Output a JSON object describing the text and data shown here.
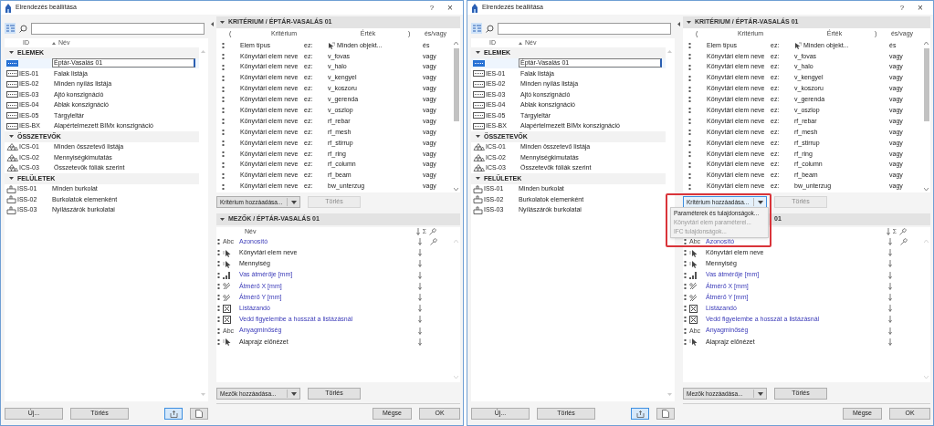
{
  "dialogs": [
    {
      "title": "Elrendezés beállítása",
      "help": "?",
      "close": "×",
      "list": {
        "columns": [
          "ID",
          "Név"
        ],
        "groups": [
          {
            "label": "ELEMEK",
            "expanded": true,
            "kind": "elements",
            "items": [
              {
                "name": "Éptár-Vasalás 01",
                "selected": true
              },
              {
                "id": "IES-01",
                "name": "Falak listája",
                "selected": false
              },
              {
                "id": "IES-02",
                "name": "Minden nyílás listája",
                "selected": false
              },
              {
                "id": "IES-03",
                "name": "Ajtó konszignáció",
                "selected": false
              },
              {
                "id": "IES-04",
                "name": "Ablak konszignáció",
                "selected": false
              },
              {
                "id": "IES-05",
                "name": "Tárgyleltár",
                "selected": false
              },
              {
                "id": "IES-BX",
                "name": "Alapértelmezett BIMx konszignáció",
                "selected": false
              }
            ]
          },
          {
            "label": "ÖSSZETEVŐK",
            "expanded": true,
            "kind": "components",
            "items": [
              {
                "id": "ICS-01",
                "name": "Minden összetevő listája",
                "selected": false
              },
              {
                "id": "ICS-02",
                "name": "Mennyiségkimutatás",
                "selected": false
              },
              {
                "id": "ICS-03",
                "name": "Összetevők fóliák szerint",
                "selected": false
              }
            ]
          },
          {
            "label": "FELÜLETEK",
            "expanded": true,
            "kind": "surfaces",
            "items": [
              {
                "id": "ISS-01",
                "name": "Minden burkolat",
                "selected": false
              },
              {
                "id": "ISS-02",
                "name": "Burkolatok elemenként",
                "selected": false
              },
              {
                "id": "ISS-03",
                "name": "Nyílászárók burkolatai",
                "selected": false
              }
            ]
          }
        ]
      },
      "criteria": {
        "title": "KRITÉRIUM / ÉPTÁR-VASALÁS 01",
        "expanded": true,
        "columns": [
          "(",
          "Kritérium",
          "Érték",
          ")",
          "és/vagy"
        ],
        "rows": [
          {
            "kind": "type",
            "criterion": "Elem típus",
            "operator": "ez:",
            "value": "Minden objekt...",
            "logic": "és"
          },
          {
            "kind": "name",
            "criterion": "Könyvtári elem neve",
            "operator": "ez:",
            "value": "v_fovas",
            "logic": "vagy"
          },
          {
            "kind": "name",
            "criterion": "Könyvtári elem neve",
            "operator": "ez:",
            "value": "v_halo",
            "logic": "vagy"
          },
          {
            "kind": "name",
            "criterion": "Könyvtári elem neve",
            "operator": "ez:",
            "value": "v_kengyel",
            "logic": "vagy"
          },
          {
            "kind": "name",
            "criterion": "Könyvtári elem neve",
            "operator": "ez:",
            "value": "v_koszoru",
            "logic": "vagy"
          },
          {
            "kind": "name",
            "criterion": "Könyvtári elem neve",
            "operator": "ez:",
            "value": "v_gerenda",
            "logic": "vagy"
          },
          {
            "kind": "name",
            "criterion": "Könyvtári elem neve",
            "operator": "ez:",
            "value": "v_oszlop",
            "logic": "vagy"
          },
          {
            "kind": "name",
            "criterion": "Könyvtári elem neve",
            "operator": "ez:",
            "value": "rf_rebar",
            "logic": "vagy"
          },
          {
            "kind": "name",
            "criterion": "Könyvtári elem neve",
            "operator": "ez:",
            "value": "rf_mesh",
            "logic": "vagy"
          },
          {
            "kind": "name",
            "criterion": "Könyvtári elem neve",
            "operator": "ez:",
            "value": "rf_stirrup",
            "logic": "vagy"
          },
          {
            "kind": "name",
            "criterion": "Könyvtári elem neve",
            "operator": "ez:",
            "value": "rf_ring",
            "logic": "vagy"
          },
          {
            "kind": "name",
            "criterion": "Könyvtári elem neve",
            "operator": "ez:",
            "value": "rf_column",
            "logic": "vagy"
          },
          {
            "kind": "name",
            "criterion": "Könyvtári elem neve",
            "operator": "ez:",
            "value": "rf_beam",
            "logic": "vagy"
          },
          {
            "kind": "name",
            "criterion": "Könyvtári elem neve",
            "operator": "ez:",
            "value": "bw_unterzug",
            "logic": "vagy"
          }
        ],
        "add": "Kritérium hozzáadása...",
        "add_open": false,
        "delete": "Törlés",
        "delete_disabled": true
      },
      "fields": {
        "title": "MEZŐK / ÉPTÁR-VASALÁS 01",
        "expanded": true,
        "column": "Név",
        "sum_label": "Σ",
        "rows": [
          {
            "kind": "text",
            "icon_label": "Abc",
            "name": "Azonosító",
            "parameter": true,
            "pinned": true
          },
          {
            "kind": "pointer",
            "name": "Könyvtári elem neve",
            "parameter": false,
            "pinned": false
          },
          {
            "kind": "pointer",
            "name": "Mennyiség",
            "parameter": false,
            "pinned": false
          },
          {
            "kind": "bars",
            "name": "Vas átmérője [mm]",
            "parameter": true,
            "pinned": false
          },
          {
            "kind": "diameter",
            "name": "Átmérő X [mm]",
            "parameter": true,
            "pinned": false
          },
          {
            "kind": "diameter",
            "name": "Átmérő Y [mm]",
            "parameter": true,
            "pinned": false
          },
          {
            "kind": "check",
            "name": "Listázandó",
            "parameter": true,
            "pinned": false
          },
          {
            "kind": "check",
            "name": "Vedd figyelembe a hosszát a listázásnál",
            "parameter": true,
            "pinned": false
          },
          {
            "kind": "text",
            "icon_label": "Abc",
            "name": "Anyagminőség",
            "parameter": true,
            "pinned": false
          },
          {
            "kind": "pointer",
            "name": "Alaprajz előnézet",
            "parameter": false,
            "pinned": false
          }
        ],
        "add": "Mezők hozzáadása...",
        "delete": "Törlés",
        "delete_disabled": false
      },
      "new": "Új...",
      "delete": "Törlés",
      "view_buttons": [
        {
          "selected": true
        },
        {
          "selected": false
        }
      ],
      "cancel": "Mégse",
      "ok": "OK"
    },
    {
      "title": "Elrendezés beállítása",
      "help": "?",
      "close": "×",
      "list": {
        "columns": [
          "ID",
          "Név"
        ],
        "groups": [
          {
            "label": "ELEMEK",
            "expanded": true,
            "kind": "elements",
            "items": [
              {
                "name": "Éptár-Vasalás 01",
                "selected": true
              },
              {
                "id": "IES-01",
                "name": "Falak listája",
                "selected": false
              },
              {
                "id": "IES-02",
                "name": "Minden nyílás listája",
                "selected": false
              },
              {
                "id": "IES-03",
                "name": "Ajtó konszignáció",
                "selected": false
              },
              {
                "id": "IES-04",
                "name": "Ablak konszignáció",
                "selected": false
              },
              {
                "id": "IES-05",
                "name": "Tárgyleltár",
                "selected": false
              },
              {
                "id": "IES-BX",
                "name": "Alapértelmezett BIMx konszignáció",
                "selected": false
              }
            ]
          },
          {
            "label": "ÖSSZETEVŐK",
            "expanded": true,
            "kind": "components",
            "items": [
              {
                "id": "ICS-01",
                "name": "Minden összetevő listája",
                "selected": false
              },
              {
                "id": "ICS-02",
                "name": "Mennyiségkimutatás",
                "selected": false
              },
              {
                "id": "ICS-03",
                "name": "Összetevők fóliák szerint",
                "selected": false
              }
            ]
          },
          {
            "label": "FELÜLETEK",
            "expanded": true,
            "kind": "surfaces",
            "items": [
              {
                "id": "ISS-01",
                "name": "Minden burkolat",
                "selected": false
              },
              {
                "id": "ISS-02",
                "name": "Burkolatok elemenként",
                "selected": false
              },
              {
                "id": "ISS-03",
                "name": "Nyílászárók burkolatai",
                "selected": false
              }
            ]
          }
        ]
      },
      "criteria": {
        "title": "KRITÉRIUM / ÉPTÁR-VASALÁS 01",
        "expanded": true,
        "columns": [
          "(",
          "Kritérium",
          "Érték",
          ")",
          "és/vagy"
        ],
        "rows": [
          {
            "kind": "type",
            "criterion": "Elem típus",
            "operator": "ez:",
            "value": "Minden objekt...",
            "logic": "és"
          },
          {
            "kind": "name",
            "criterion": "Könyvtári elem neve",
            "operator": "ez:",
            "value": "v_fovas",
            "logic": "vagy"
          },
          {
            "kind": "name",
            "criterion": "Könyvtári elem neve",
            "operator": "ez:",
            "value": "v_halo",
            "logic": "vagy"
          },
          {
            "kind": "name",
            "criterion": "Könyvtári elem neve",
            "operator": "ez:",
            "value": "v_kengyel",
            "logic": "vagy"
          },
          {
            "kind": "name",
            "criterion": "Könyvtári elem neve",
            "operator": "ez:",
            "value": "v_koszoru",
            "logic": "vagy"
          },
          {
            "kind": "name",
            "criterion": "Könyvtári elem neve",
            "operator": "ez:",
            "value": "v_gerenda",
            "logic": "vagy"
          },
          {
            "kind": "name",
            "criterion": "Könyvtári elem neve",
            "operator": "ez:",
            "value": "v_oszlop",
            "logic": "vagy"
          },
          {
            "kind": "name",
            "criterion": "Könyvtári elem neve",
            "operator": "ez:",
            "value": "rf_rebar",
            "logic": "vagy"
          },
          {
            "kind": "name",
            "criterion": "Könyvtári elem neve",
            "operator": "ez:",
            "value": "rf_mesh",
            "logic": "vagy"
          },
          {
            "kind": "name",
            "criterion": "Könyvtári elem neve",
            "operator": "ez:",
            "value": "rf_stirrup",
            "logic": "vagy"
          },
          {
            "kind": "name",
            "criterion": "Könyvtári elem neve",
            "operator": "ez:",
            "value": "rf_ring",
            "logic": "vagy"
          },
          {
            "kind": "name",
            "criterion": "Könyvtári elem neve",
            "operator": "ez:",
            "value": "rf_column",
            "logic": "vagy"
          },
          {
            "kind": "name",
            "criterion": "Könyvtári elem neve",
            "operator": "ez:",
            "value": "rf_beam",
            "logic": "vagy"
          },
          {
            "kind": "name",
            "criterion": "Könyvtári elem neve",
            "operator": "ez:",
            "value": "bw_unterzug",
            "logic": "vagy"
          }
        ],
        "add": "Kritérium hozzáadása...",
        "add_open": true,
        "delete": "Törlés",
        "delete_disabled": true
      },
      "fields": {
        "title": "01",
        "sum_label": "Σ",
        "rows": [
          {
            "kind": "text",
            "icon_label": "Abc",
            "name": "Azonosító",
            "parameter": true,
            "pinned": true
          },
          {
            "kind": "pointer",
            "name": "Könyvtári elem neve",
            "parameter": false,
            "pinned": false
          },
          {
            "kind": "pointer",
            "name": "Mennyiség",
            "parameter": false,
            "pinned": false
          },
          {
            "kind": "bars",
            "name": "Vas átmérője [mm]",
            "parameter": true,
            "pinned": false
          },
          {
            "kind": "diameter",
            "name": "Átmérő X [mm]",
            "parameter": true,
            "pinned": false
          },
          {
            "kind": "diameter",
            "name": "Átmérő Y [mm]",
            "parameter": true,
            "pinned": false
          },
          {
            "kind": "check",
            "name": "Listázandó",
            "parameter": true,
            "pinned": false
          },
          {
            "kind": "check",
            "name": "Vedd figyelembe a hosszát a listázásnál",
            "parameter": true,
            "pinned": false
          },
          {
            "kind": "text",
            "icon_label": "Abc",
            "name": "Anyagminőség",
            "parameter": true,
            "pinned": false
          },
          {
            "kind": "pointer",
            "name": "Alaprajz előnézet",
            "parameter": false,
            "pinned": false
          }
        ],
        "add": "Mezők hozzáadása...",
        "delete": "Törlés",
        "delete_disabled": false
      },
      "new": "Új...",
      "delete": "Törlés",
      "view_buttons": [
        {
          "selected": true
        },
        {
          "selected": false
        }
      ],
      "cancel": "Mégse",
      "ok": "OK",
      "menu": {
        "highlighted": true,
        "items": [
          {
            "label": "Paraméterek és tulajdonságok...",
            "disabled": false
          },
          {
            "label": "Könyvtári elem paraméterei...",
            "disabled": true
          },
          {
            "label": "IFC tulajdonságok...",
            "disabled": true
          }
        ]
      }
    }
  ]
}
